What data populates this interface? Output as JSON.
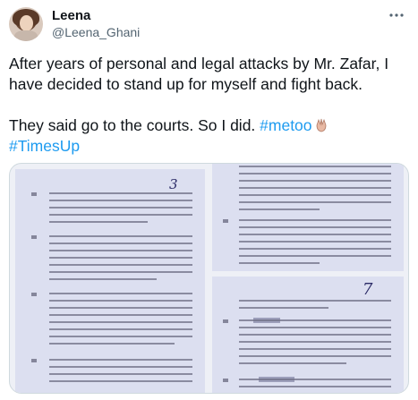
{
  "user": {
    "display_name": "Leena",
    "handle": "@Leena_Ghani"
  },
  "tweet": {
    "line1": "After years of personal and legal attacks by Mr. Zafar, I have decided to stand up for myself and fight back.",
    "line2_text": "They said go to the courts. So I did. ",
    "hashtag_metoo": "#metoo",
    "hashtag_timesup": "#TimesUp"
  },
  "icons": {
    "more": "more-horizontal-icon",
    "emoji": "raised-hands-emoji"
  },
  "media": {
    "page_marks": [
      "3",
      "7"
    ]
  }
}
